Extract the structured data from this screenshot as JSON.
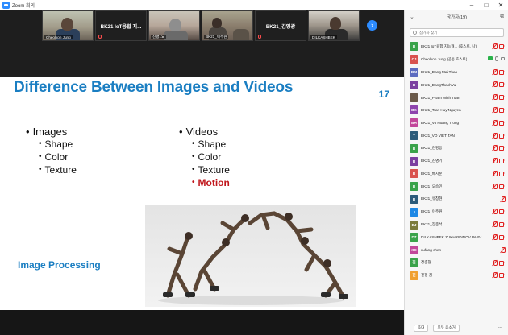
{
  "window": {
    "title": "Zoom 회의",
    "controls": [
      "–",
      "□",
      "✕"
    ]
  },
  "filmstrip": {
    "tiles": [
      {
        "name": "Cheolkon Jung",
        "kind": "video"
      },
      {
        "name": "BK21 IoT융합 지...",
        "kind": "name"
      },
      {
        "name": "진평..요",
        "kind": "video"
      },
      {
        "name": "BK21_이주원",
        "kind": "video"
      },
      {
        "name": "BK21_김영광",
        "kind": "name"
      },
      {
        "name": "DILKASHBEK",
        "kind": "video"
      }
    ],
    "next_icon": "›"
  },
  "slide": {
    "title": "Difference Between Images and Videos",
    "number": "17",
    "images_column": {
      "heading": "Images",
      "items": [
        "Shape",
        "Color",
        "Texture"
      ]
    },
    "videos_column": {
      "heading": "Videos",
      "items": [
        "Shape",
        "Color",
        "Texture"
      ],
      "highlight_item": "Motion"
    },
    "footer_label": "Image Processing",
    "photo_icon": "motion-sequence-photo"
  },
  "panel": {
    "title": "참가자(19)",
    "search_placeholder": "참가자 찾기",
    "participants": [
      {
        "initials": "B",
        "name": "BK21 IoT융합 지능형... (호스트, 나)",
        "color": "#3aa34a"
      },
      {
        "initials": "CJ",
        "name": "Cheolkon Jung (공동 호스트)",
        "color": "#d9534f"
      },
      {
        "initials": "BM",
        "name": "BK21_Dang Mai Thao",
        "color": "#5c6bc0"
      },
      {
        "initials": "B",
        "name": "BK21_DangThanhVu",
        "color": "#7b3fa0"
      },
      {
        "initials": "",
        "name": "BK21_Pham Minh Tuan",
        "color": "#6b5a4a"
      },
      {
        "initials": "BK",
        "name": "BK21_Tran Huy Nguyen",
        "color": "#8e44ad"
      },
      {
        "initials": "BH",
        "name": "BK21_Vo Hoang Trong",
        "color": "#c2479a"
      },
      {
        "initials": "T",
        "name": "BK21_VO VIET TAN",
        "color": "#2c5b7a"
      },
      {
        "initials": "B",
        "name": "BK21_김명응",
        "color": "#3aa34a"
      },
      {
        "initials": "B",
        "name": "BK21_김명기",
        "color": "#7b3fa0"
      },
      {
        "initials": "B",
        "name": "BK21_배지훈",
        "color": "#d9534f"
      },
      {
        "initials": "B",
        "name": "BK21_오승민",
        "color": "#3aa34a"
      },
      {
        "initials": "B",
        "name": "BK21_유창현",
        "color": "#2c5b7a"
      },
      {
        "initials": "J",
        "name": "BK21_이주원",
        "color": "#1e88e5"
      },
      {
        "initials": "BJ",
        "name": "BK21_장종석",
        "color": "#7a7a3a"
      },
      {
        "initials": "DZ",
        "name": "DILKASHBEK ZUKHRIDINOV PARV...",
        "color": "#3aa34a"
      },
      {
        "initials": "XC",
        "name": "xufang chen",
        "color": "#c2479a"
      },
      {
        "initials": "진",
        "name": "정종현",
        "color": "#3aa34a"
      },
      {
        "initials": "진",
        "name": "진평 김",
        "color": "#f0a030"
      }
    ],
    "footer": {
      "invite": "초대",
      "mute_all": "모두 음소거",
      "more": "..."
    }
  }
}
